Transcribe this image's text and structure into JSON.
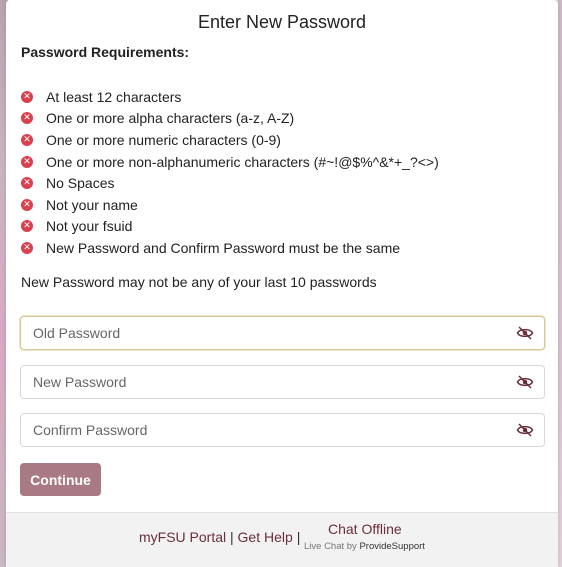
{
  "page": {
    "title": "Enter New Password",
    "requirements_heading": "Password Requirements:",
    "requirements": [
      "At least 12 characters",
      "One or more alpha characters (a-z, A-Z)",
      "One or more numeric characters (0-9)",
      "One or more non-alphanumeric characters (#~!@$%^&*+_?<>)",
      "No Spaces",
      "Not your name",
      "Not your fsuid",
      "New Password and Confirm Password must be the same"
    ],
    "requirement_status_icon": "x-circle-icon",
    "history_note": "New Password may not be any of your last 10 passwords"
  },
  "form": {
    "old_password": {
      "placeholder": "Old Password",
      "value": ""
    },
    "new_password": {
      "placeholder": "New Password",
      "value": ""
    },
    "confirm_password": {
      "placeholder": "Confirm Password",
      "value": ""
    },
    "continue_label": "Continue"
  },
  "footer": {
    "portal_link": "myFSU Portal",
    "separator": "|",
    "help_link": "Get Help",
    "chat_status": "Chat Offline",
    "chat_credit_prefix": "Live Chat by ",
    "chat_credit_brand": "ProvideSupport"
  },
  "colors": {
    "accent": "#6b2f3b",
    "button": "#a87a84",
    "error_icon": "#d9414e"
  }
}
